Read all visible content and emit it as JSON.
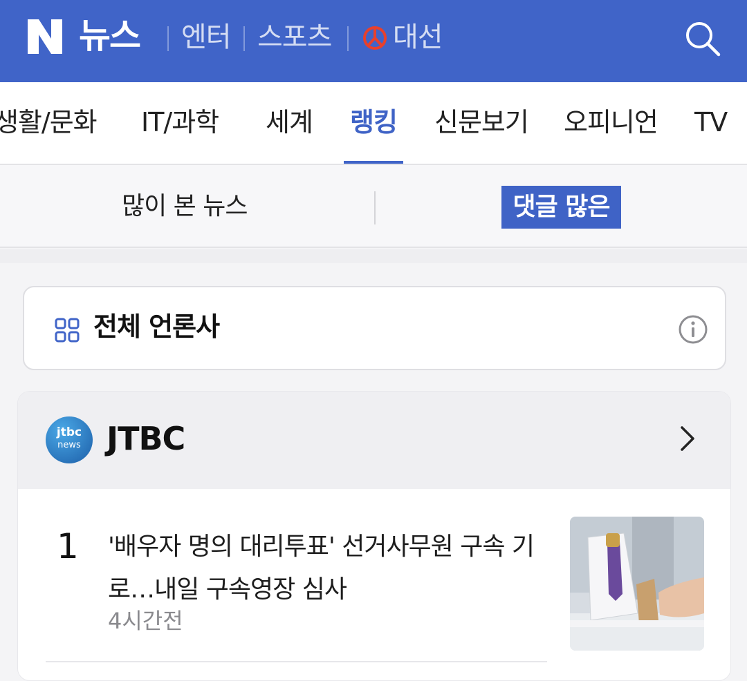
{
  "header": {
    "logo_letter": "N",
    "brand": "뉴스",
    "links": [
      "엔터",
      "스포츠",
      "대선"
    ],
    "colors": {
      "header_bg": "#4064c8",
      "accent": "#3f63c6",
      "election_icon": "#e8402c"
    }
  },
  "categories": [
    {
      "label": "생활/문화",
      "active": false
    },
    {
      "label": "IT/과학",
      "active": false
    },
    {
      "label": "세계",
      "active": false
    },
    {
      "label": "랭킹",
      "active": true
    },
    {
      "label": "신문보기",
      "active": false
    },
    {
      "label": "오피니언",
      "active": false
    },
    {
      "label": "TV",
      "active": false
    }
  ],
  "subtabs": {
    "most_viewed": "많이 본 뉴스",
    "most_commented": "댓글 많은",
    "active": "most_commented"
  },
  "press_filter": {
    "label": "전체 언론사",
    "icons": [
      "grid-icon",
      "info-icon"
    ]
  },
  "press_card": {
    "logo_text_top": "jtbc",
    "logo_text_bottom": "news",
    "name": "JTBC",
    "articles": [
      {
        "rank": "1",
        "title": "'배우자 명의 대리투표' 선거사무원 구속 기로…내일 구속영장 심사",
        "time": "4시간전"
      }
    ]
  }
}
